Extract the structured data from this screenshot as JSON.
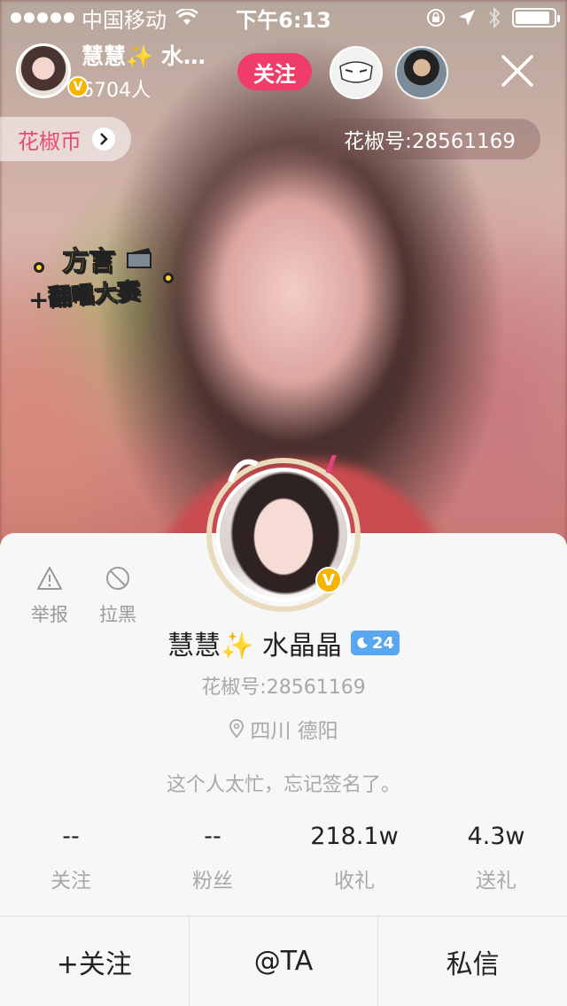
{
  "status_bar": {
    "carrier": "中国移动",
    "time": "下午6:13",
    "battery_level": 0.9
  },
  "host": {
    "name": "慧慧✨ 水…",
    "viewer_count": "6704人",
    "follow_label": "关注"
  },
  "coin": {
    "label": "花椒币"
  },
  "room_id": "花椒号:28561169",
  "event": {
    "line1": "方言",
    "line2": "翻唱大赛"
  },
  "profile": {
    "name": "慧慧✨ 水晶晶",
    "level": "24",
    "id": "花椒号:28561169",
    "location": "四川 德阳",
    "signature": "这个人太忙，忘记签名了。",
    "report_label": "举报",
    "block_label": "拉黑",
    "stats": [
      {
        "value": "--",
        "label": "关注"
      },
      {
        "value": "--",
        "label": "粉丝"
      },
      {
        "value": "218.1w",
        "label": "收礼"
      },
      {
        "value": "4.3w",
        "label": "送礼"
      }
    ],
    "actions": {
      "follow": "+关注",
      "mention": "@TA",
      "message": "私信"
    }
  },
  "colors": {
    "accent_pink": "#ef3c68",
    "badge_gold": "#f4b400",
    "level_blue": "#59a7f0"
  }
}
